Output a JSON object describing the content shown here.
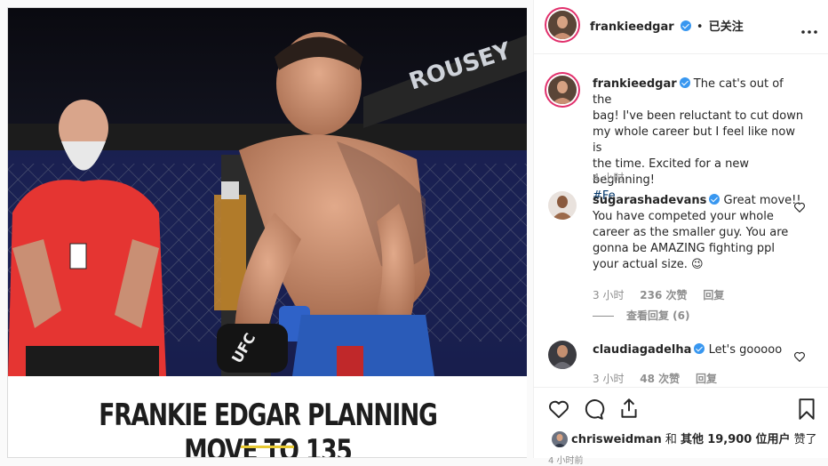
{
  "post": {
    "headline": "FRANKIE EDGAR PLANNING MOVE TO 135",
    "photo_banner_text": "ROUSEY",
    "glove_text": "UFC"
  },
  "header": {
    "username": "frankieedgar",
    "separator": "•",
    "follow_status": "已关注",
    "more_icon": "more-horizontal-icon"
  },
  "caption": {
    "username": "frankieedgar",
    "text_lines": [
      "The cat's out of the",
      "bag! I've been reluctant to cut down",
      "my whole career but I feel like now is",
      "the time. Excited for a new beginning!",
      "#Fe"
    ],
    "time": "4 小时"
  },
  "comments": [
    {
      "username": "sugarashadevans",
      "text_lines": [
        "Great move!!",
        "You have competed your whole",
        "career as the smaller guy. You are",
        "gonna be AMAZING fighting ppl",
        "your actual size. 😉"
      ],
      "time": "3 小时",
      "likes": "236 次赞",
      "reply": "回复",
      "view_replies": "查看回复 (6)"
    },
    {
      "username": "claudiagadelha",
      "text_lines": [
        "Let's gooooo"
      ],
      "time": "3 小时",
      "likes": "48 次赞",
      "reply": "回复"
    }
  ],
  "actions": {
    "like_icon": "heart-icon",
    "comment_icon": "comment-icon",
    "share_icon": "share-icon",
    "save_icon": "bookmark-icon"
  },
  "likes": {
    "liker": "chrisweidman",
    "joiner": "和",
    "others_label": "其他",
    "count": "19,900",
    "users_label": "位用户",
    "liked_label": "赞了"
  },
  "post_time_partial": "4 小时前"
}
